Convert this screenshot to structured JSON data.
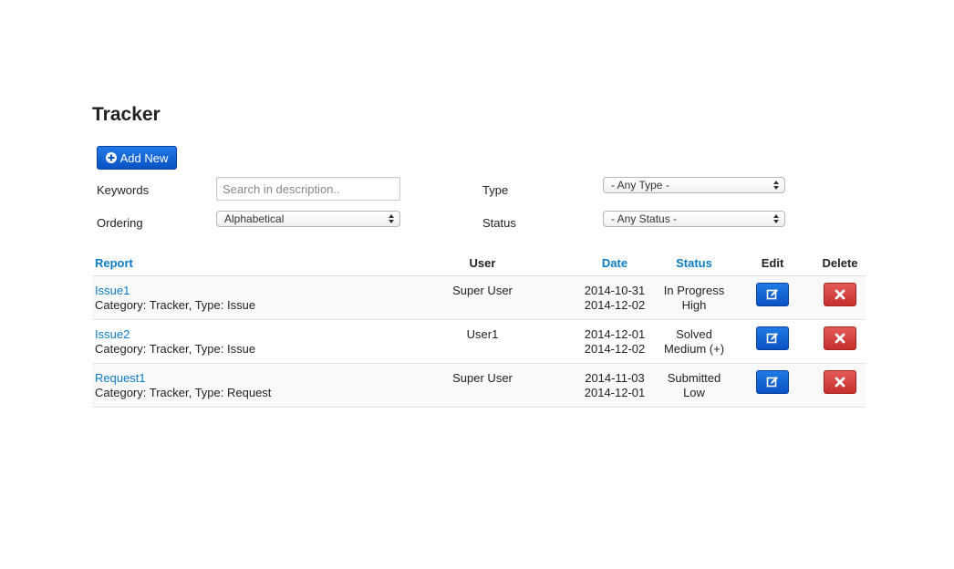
{
  "page": {
    "title": "Tracker"
  },
  "toolbar": {
    "add_label": "Add New"
  },
  "filters": {
    "keywords_label": "Keywords",
    "keywords_placeholder": "Search in description..",
    "ordering_label": "Ordering",
    "ordering_value": "Alphabetical",
    "type_label": "Type",
    "type_value": "- Any Type -",
    "status_label": "Status",
    "status_value": "- Any Status -"
  },
  "table": {
    "headers": {
      "report": "Report",
      "user": "User",
      "date": "Date",
      "status": "Status",
      "edit": "Edit",
      "delete": "Delete"
    },
    "rows": [
      {
        "title": "Issue1",
        "meta": "Category: Tracker, Type: Issue",
        "user": "Super User",
        "date1": "2014-10-31",
        "date2": "2014-12-02",
        "status": "In Progress",
        "priority": "High"
      },
      {
        "title": "Issue2",
        "meta": "Category: Tracker, Type: Issue",
        "user": "User1",
        "date1": "2014-12-01",
        "date2": "2014-12-02",
        "status": "Solved",
        "priority": "Medium (+)"
      },
      {
        "title": "Request1",
        "meta": "Category: Tracker, Type: Request",
        "user": "Super User",
        "date1": "2014-11-03",
        "date2": "2014-12-01",
        "status": "Submitted",
        "priority": "Low"
      }
    ]
  },
  "colors": {
    "link": "#0b7bc3",
    "primary": "#0a52c4",
    "danger": "#c72f2b"
  }
}
